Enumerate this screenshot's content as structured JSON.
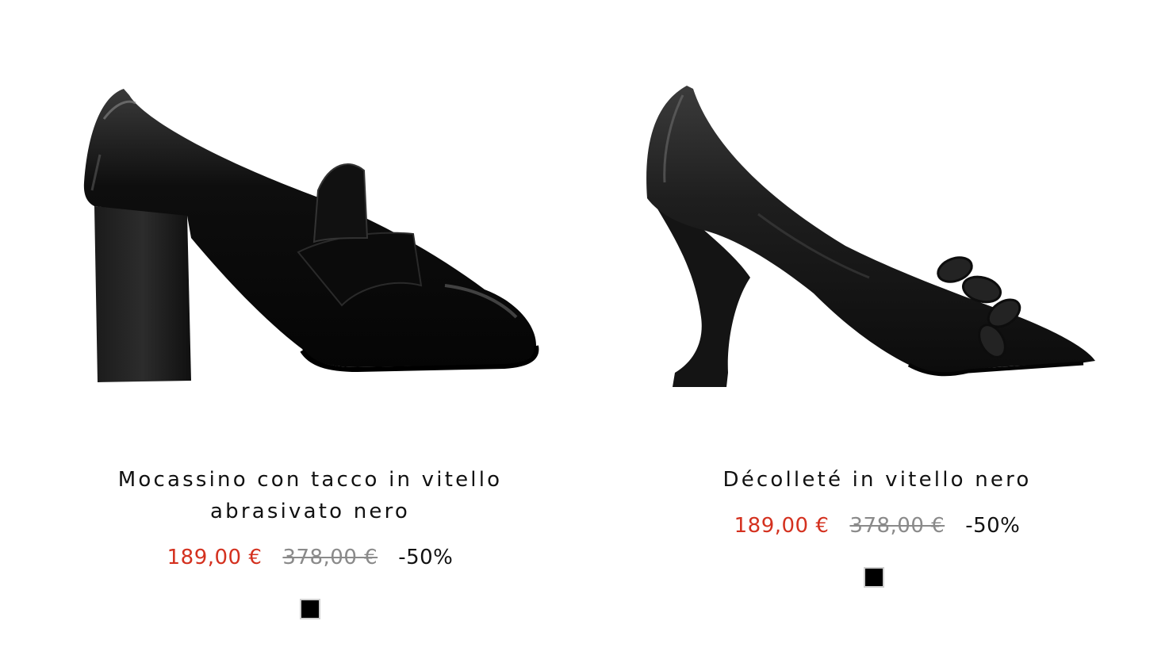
{
  "products": [
    {
      "name_line1": "Mocassino con tacco in vitello",
      "name_line2": "abrasivato nero",
      "price_sale": "189,00 €",
      "price_original": "378,00 €",
      "discount": "-50%",
      "image": "black-patent-heeled-loafer",
      "swatch_color": "#000000"
    },
    {
      "name_line1": "Décolleté in vitello nero",
      "price_sale": "189,00 €",
      "price_original": "378,00 €",
      "discount": "-50%",
      "image": "black-pointed-pump-with-chain",
      "swatch_color": "#000000"
    }
  ],
  "colors": {
    "sale_price": "#d4311f",
    "original_price": "#8a8a8a",
    "text": "#111111"
  }
}
